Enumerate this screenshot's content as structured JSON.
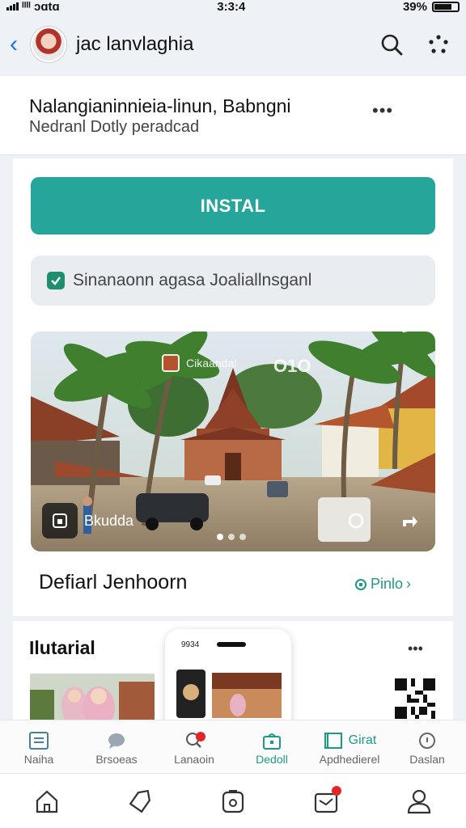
{
  "status_bar": {
    "carrier": "ᴵᴵᴵᴵ ɔɑtɑ",
    "time": "3:3:4",
    "battery": "39%"
  },
  "header": {
    "back_icon": "chevron-left-icon",
    "title": "jac lanvlaghia",
    "search_icon": "search-icon",
    "menu_icon": "dots-grid-icon"
  },
  "app": {
    "name": "Nalangianinnieia-linun, Babngni",
    "subtitle": "Nedranl Dotly peradcad",
    "more": "•••"
  },
  "install_button": "INSTAL",
  "notice": "Sinanaonn agasa Joaliallnsganl",
  "hero": {
    "tag": "Cikaandal",
    "counter": "О1О",
    "chip_label": "Bkudda"
  },
  "section": {
    "title": "Defiarl Jenhoorn",
    "link": "Pinlo"
  },
  "tutorial": {
    "title": "Ilutarial",
    "more": "•••",
    "phone_time": "9934"
  },
  "tabs": [
    {
      "label": "Naiha",
      "icon": "document-icon",
      "active": false
    },
    {
      "label": "Brsoeas",
      "icon": "chat-icon",
      "active": false
    },
    {
      "label": "Lanaoin",
      "icon": "search-icon",
      "active": false
    },
    {
      "label": "Dedoll",
      "icon": "bag-icon",
      "active": true
    },
    {
      "label": "Apdhedierel",
      "icon": "book-icon",
      "active": false
    },
    {
      "label": "Daslan",
      "icon": "help-icon",
      "active": false
    }
  ],
  "tab_extra": "Girat",
  "nav": [
    {
      "icon": "home-icon"
    },
    {
      "icon": "tag-icon"
    },
    {
      "icon": "camera-icon"
    },
    {
      "icon": "inbox-icon"
    },
    {
      "icon": "profile-icon"
    }
  ],
  "colors": {
    "accent": "#26a69a",
    "link": "#1d9a86",
    "badge": "#e0262b"
  }
}
